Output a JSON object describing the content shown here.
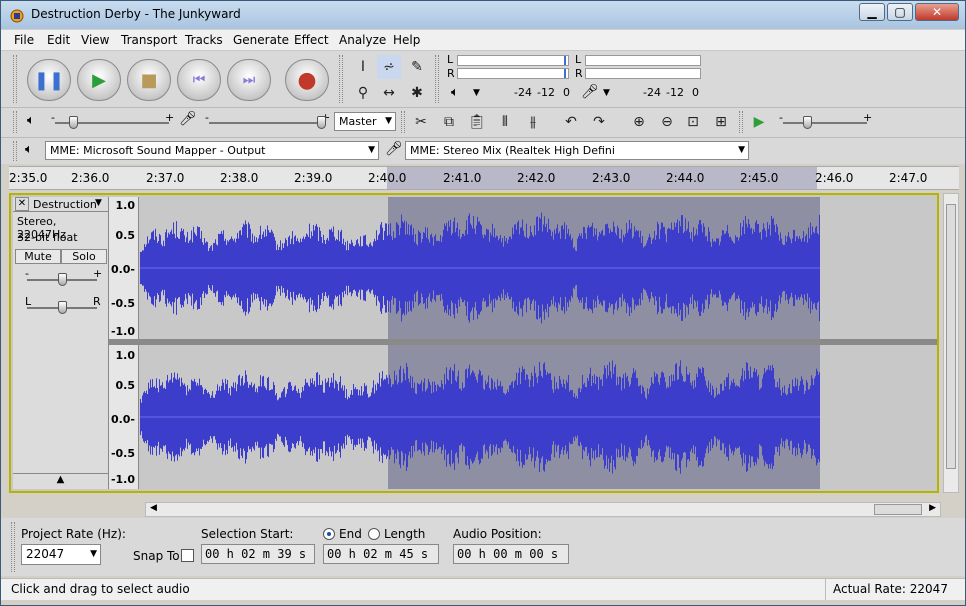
{
  "window": {
    "title": "Destruction Derby - The Junkyward"
  },
  "menu": [
    "File",
    "Edit",
    "View",
    "Transport",
    "Tracks",
    "Generate",
    "Effect",
    "Analyze",
    "Help"
  ],
  "meters": {
    "play": {
      "ticks": [
        "-24",
        "-12",
        "0"
      ],
      "channels": [
        "L",
        "R"
      ]
    },
    "record": {
      "ticks": [
        "-24",
        "-12",
        "0"
      ],
      "channels": [
        "L",
        "R"
      ]
    }
  },
  "mixer": {
    "input_source": "Master"
  },
  "devices": {
    "output": "MME: Microsoft Sound Mapper - Output",
    "input": "MME: Stereo Mix (Realtek High Defini"
  },
  "ruler": {
    "labels": [
      "2:35.0",
      "2:36.0",
      "2:37.0",
      "2:38.0",
      "2:39.0",
      "2:40.0",
      "2:41.0",
      "2:42.0",
      "2:43.0",
      "2:44.0",
      "2:45.0",
      "2:46.0",
      "2:47.0"
    ]
  },
  "track": {
    "name": "Destruction",
    "info_line1": "Stereo, 22047Hz",
    "info_line2": "32-bit float",
    "mute_label": "Mute",
    "solo_label": "Solo",
    "gain_minus": "-",
    "gain_plus": "+",
    "pan_left": "L",
    "pan_right": "R",
    "scale": [
      "1.0",
      "0.5",
      "0.0-",
      "-0.5",
      "-1.0"
    ]
  },
  "selection_bar": {
    "project_rate_label": "Project Rate (Hz):",
    "project_rate": "22047",
    "snap_to_label": "Snap To",
    "selection_start_label": "Selection Start:",
    "end_label": "End",
    "length_label": "Length",
    "audio_position_label": "Audio Position:",
    "selection_start": "00 h 02 m 39 s",
    "selection_end": "00 h 02 m 45 s",
    "audio_position": "00 h 00 m 00 s"
  },
  "status": {
    "left": "Click and drag to select audio",
    "right": "Actual Rate: 22047"
  },
  "colors": {
    "waveform": "#3d3dcc",
    "waveform_selected": "#3333cc",
    "selection_bg": "#8f8fa3",
    "track_bg": "#c8c8c8",
    "record_button": "#c0392b",
    "play_button": "#2e9e3a"
  }
}
